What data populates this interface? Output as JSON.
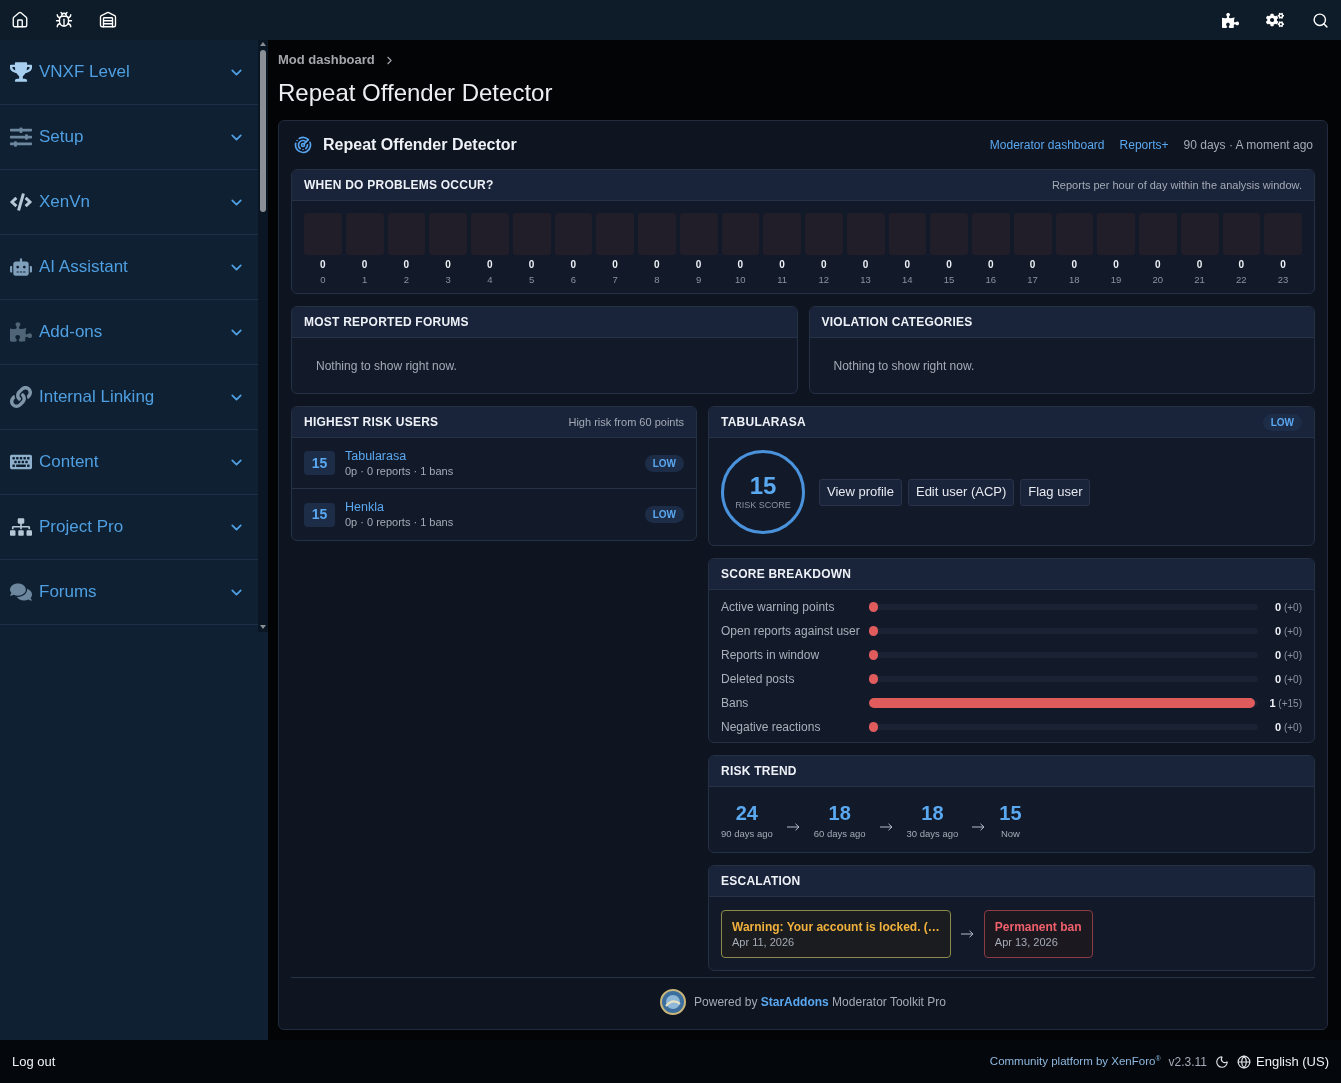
{
  "sidebar": {
    "items": [
      {
        "label": "VNXF Level"
      },
      {
        "label": "Setup"
      },
      {
        "label": "XenVn"
      },
      {
        "label": "AI Assistant"
      },
      {
        "label": "Add-ons"
      },
      {
        "label": "Internal Linking"
      },
      {
        "label": "Content"
      },
      {
        "label": "Project Pro"
      },
      {
        "label": "Forums"
      }
    ]
  },
  "breadcrumb": [
    "Mod dashboard"
  ],
  "page_title": "Repeat Offender Detector",
  "card": {
    "title": "Repeat Offender Detector",
    "links": [
      "Moderator dashboard",
      "Reports+"
    ],
    "meta": "90 days · A moment ago"
  },
  "hourly_panel": {
    "title": "WHEN DO PROBLEMS OCCUR?",
    "note": "Reports per hour of day within the analysis window.",
    "hours": [
      {
        "hour": "0",
        "count": "0"
      },
      {
        "hour": "1",
        "count": "0"
      },
      {
        "hour": "2",
        "count": "0"
      },
      {
        "hour": "3",
        "count": "0"
      },
      {
        "hour": "4",
        "count": "0"
      },
      {
        "hour": "5",
        "count": "0"
      },
      {
        "hour": "6",
        "count": "0"
      },
      {
        "hour": "7",
        "count": "0"
      },
      {
        "hour": "8",
        "count": "0"
      },
      {
        "hour": "9",
        "count": "0"
      },
      {
        "hour": "10",
        "count": "0"
      },
      {
        "hour": "11",
        "count": "0"
      },
      {
        "hour": "12",
        "count": "0"
      },
      {
        "hour": "13",
        "count": "0"
      },
      {
        "hour": "14",
        "count": "0"
      },
      {
        "hour": "15",
        "count": "0"
      },
      {
        "hour": "16",
        "count": "0"
      },
      {
        "hour": "17",
        "count": "0"
      },
      {
        "hour": "18",
        "count": "0"
      },
      {
        "hour": "19",
        "count": "0"
      },
      {
        "hour": "20",
        "count": "0"
      },
      {
        "hour": "21",
        "count": "0"
      },
      {
        "hour": "22",
        "count": "0"
      },
      {
        "hour": "23",
        "count": "0"
      }
    ]
  },
  "forums_panel": {
    "title": "MOST REPORTED FORUMS",
    "empty_text": "Nothing to show right now."
  },
  "categories_panel": {
    "title": "VIOLATION CATEGORIES",
    "empty_text": "Nothing to show right now."
  },
  "risk_users": {
    "title": "HIGHEST RISK USERS",
    "note": "High risk from 60 points",
    "rows": [
      {
        "score": "15",
        "name": "Tabularasa",
        "meta": "0p · 0 reports · 1 bans",
        "risk": "LOW"
      },
      {
        "score": "15",
        "name": "Henkla",
        "meta": "0p · 0 reports · 1 bans",
        "risk": "LOW"
      }
    ]
  },
  "user_panel": {
    "title": "TABULARASA",
    "risk": "LOW",
    "score": "15",
    "score_label": "RISK SCORE",
    "buttons": [
      "View profile",
      "Edit user (ACP)",
      "Flag user"
    ]
  },
  "score_breakdown": {
    "title": "SCORE BREAKDOWN",
    "rows": [
      {
        "label": "Active warning points",
        "level": 0,
        "value": "**0** (+0)"
      },
      {
        "label": "Open reports against user",
        "level": 0,
        "value": "**0** (+0)"
      },
      {
        "label": "Reports in window",
        "level": 0,
        "value": "**0** (+0)"
      },
      {
        "label": "Deleted posts",
        "level": 0,
        "value": "**0** (+0)"
      },
      {
        "label": "Bans",
        "level": 1,
        "value": "**1** (+15)"
      },
      {
        "label": "Negative reactions",
        "level": 0,
        "value": "**0** (+0)"
      }
    ]
  },
  "risk_trend": {
    "title": "RISK TREND",
    "points": [
      {
        "value": "24",
        "label": "90 days ago"
      },
      {
        "value": "18",
        "label": "60 days ago"
      },
      {
        "value": "18",
        "label": "30 days ago"
      },
      {
        "value": "15",
        "label": "Now"
      }
    ]
  },
  "escalation": {
    "title": "ESCALATION",
    "steps": [
      {
        "kind": "warning",
        "title": "Warning: Your account is locked. (…",
        "date": "Apr 11, 2026"
      },
      {
        "kind": "ban",
        "title": "Permanent ban",
        "date": "Apr 13, 2026"
      }
    ]
  },
  "powered_by": {
    "prefix": "Powered by",
    "link": "StarAddons",
    "suffix": "Moderator Toolkit Pro"
  },
  "footer": {
    "logout": "Log out",
    "platform": "Community platform by XenForo$^{®}$",
    "version": "v2.3.11",
    "language": "English (US)"
  }
}
